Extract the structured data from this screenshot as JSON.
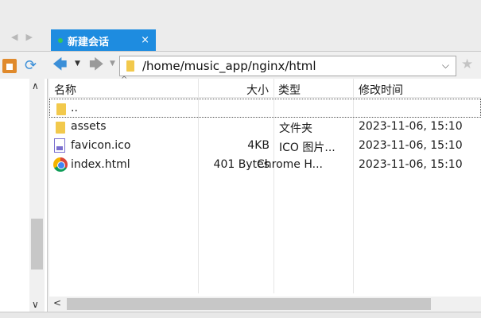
{
  "tabs": [
    {
      "label": "新建会话",
      "close": "×"
    }
  ],
  "nav": {
    "prev": "◀",
    "next": "▶"
  },
  "toolbar": {
    "home_icon": "home-icon",
    "refresh_glyph": "⟳",
    "back_glyph": "🡄",
    "dropdown_glyph": "▼",
    "forward_glyph": "🡆",
    "path": "/home/music_app/nginx/html",
    "path_dropdown": "⌵",
    "favorite_glyph": "★"
  },
  "leftpanel": {
    "scroll_up": "∧",
    "scroll_down": "∨"
  },
  "filelist": {
    "columns": {
      "name": "名称",
      "size": "大小",
      "type": "类型",
      "modified": "修改时间"
    },
    "sort_indicator": "^",
    "rows": [
      {
        "icon": "folder-icon",
        "name": "..",
        "size": "",
        "type": "",
        "modified": ""
      },
      {
        "icon": "folder-icon",
        "name": "assets",
        "size": "",
        "type": "文件夹",
        "modified": "2023-11-06, 15:10"
      },
      {
        "icon": "ico-file-icon",
        "name": "favicon.ico",
        "size": "4KB",
        "type": "ICO 图片...",
        "modified": "2023-11-06, 15:10"
      },
      {
        "icon": "chrome-html-icon",
        "name": "index.html",
        "size": "401 Bytes",
        "type": "Chrome H...",
        "modified": "2023-11-06, 15:10"
      }
    ]
  },
  "hscroll": {
    "left": "<"
  },
  "colors": {
    "tab_active": "#1e8ce0",
    "accent_blue": "#3b8fd8",
    "folder": "#f2c94c"
  }
}
